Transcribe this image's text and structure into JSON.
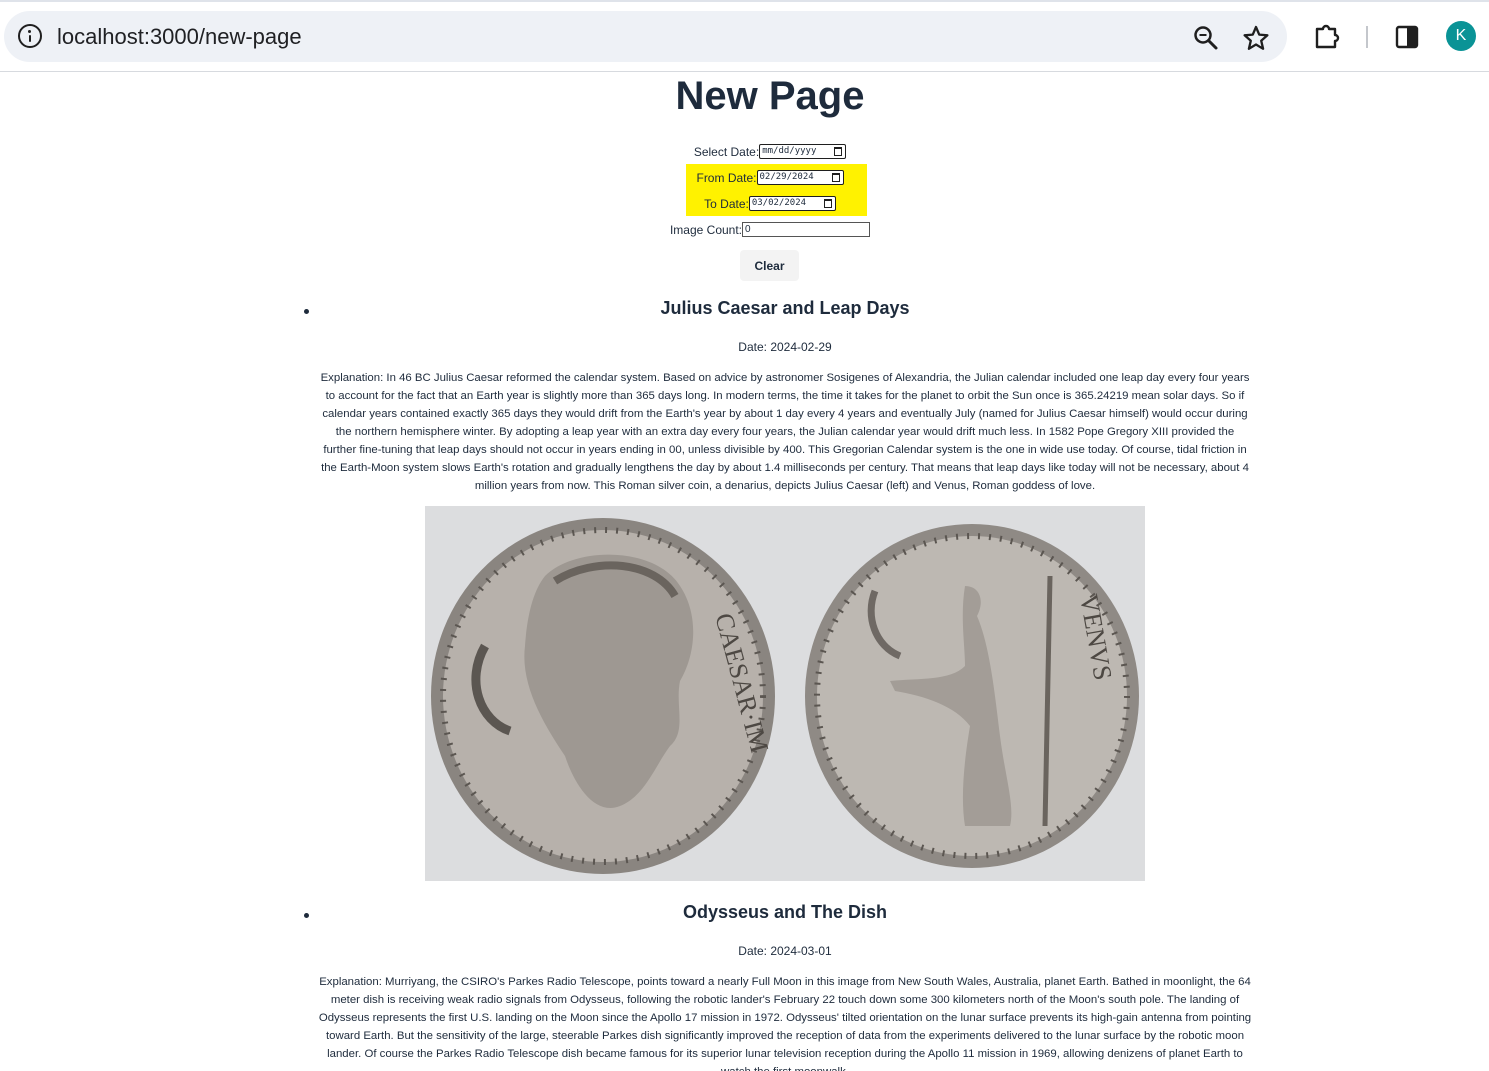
{
  "browser": {
    "url": "localhost:3000/new-page",
    "avatar_letter": "K"
  },
  "page": {
    "title": "New Page"
  },
  "form": {
    "select_date_label": "Select Date:",
    "select_date_value": "mm/dd/yyyy",
    "from_date_label": "From Date:",
    "from_date_value": "02/29/2024",
    "to_date_label": "To Date:",
    "to_date_value": "03/02/2024",
    "image_count_label": "Image Count:",
    "image_count_value": "0",
    "clear_label": "Clear",
    "highlight_color": "#fff200"
  },
  "items": [
    {
      "title": "Julius Caesar and Leap Days",
      "date": "Date: 2024-02-29",
      "explanation": "Explanation: In 46 BC Julius Caesar reformed the calendar system. Based on advice by astronomer Sosigenes of Alexandria, the Julian calendar included one leap day every four years to account for the fact that an Earth year is slightly more than 365 days long. In modern terms, the time it takes for the planet to orbit the Sun once is 365.24219 mean solar days. So if calendar years contained exactly 365 days they would drift from the Earth's year by about 1 day every 4 years and eventually July (named for Julius Caesar himself) would occur during the northern hemisphere winter. By adopting a leap year with an extra day every four years, the Julian calendar year would drift much less. In 1582 Pope Gregory XIII provided the further fine-tuning that leap days should not occur in years ending in 00, unless divisible by 400. This Gregorian Calendar system is the one in wide use today. Of course, tidal friction in the Earth-Moon system slows Earth's rotation and gradually lengthens the day by about 1.4 milliseconds per century. That means that leap days like today will not be necessary, about 4 million years from now. This Roman silver coin, a denarius, depicts Julius Caesar (left) and Venus, Roman goddess of love.",
      "coin_left_text": "CAESAR·IM",
      "coin_right_text": "VENVS"
    },
    {
      "title": "Odysseus and The Dish",
      "date": "Date: 2024-03-01",
      "explanation": "Explanation: Murriyang, the CSIRO's Parkes Radio Telescope, points toward a nearly Full Moon in this image from New South Wales, Australia, planet Earth. Bathed in moonlight, the 64 meter dish is receiving weak radio signals from Odysseus, following the robotic lander's February 22 touch down some 300 kilometers north of the Moon's south pole. The landing of Odysseus represents the first U.S. landing on the Moon since the Apollo 17 mission in 1972. Odysseus' tilted orientation on the lunar surface prevents its high-gain antenna from pointing toward Earth. But the sensitivity of the large, steerable Parkes dish significantly improved the reception of data from the experiments delivered to the lunar surface by the robotic moon lander. Of course the Parkes Radio Telescope dish became famous for its superior lunar television reception during the Apollo 11 mission in 1969, allowing denizens of planet Earth to watch the first moonwalk."
    }
  ]
}
